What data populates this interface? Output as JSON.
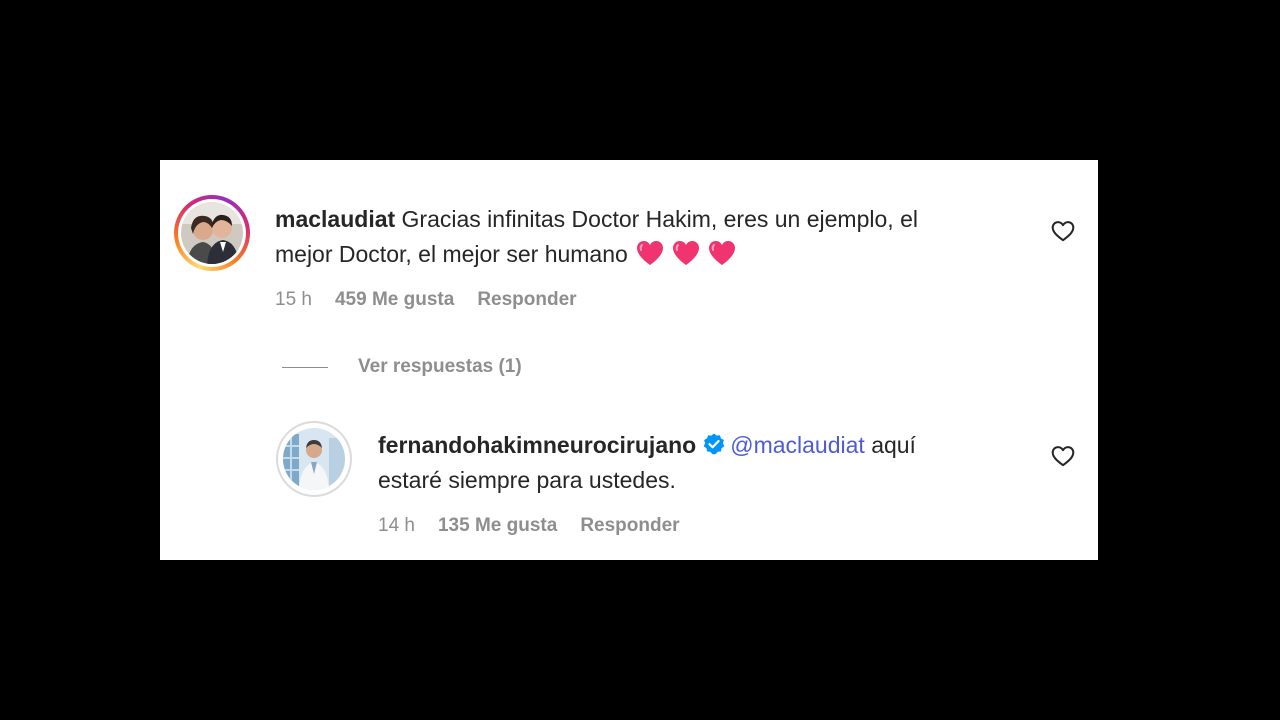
{
  "comments": [
    {
      "username": "maclaudiat",
      "text": "Gracias infinitas Doctor Hakim, eres un ejemplo, el",
      "text_line2": "mejor Doctor, el mejor ser humano",
      "emojis": [
        "pink-heart",
        "pink-heart",
        "pink-heart"
      ],
      "time": "15 h",
      "likes": "459 Me gusta",
      "reply_label": "Responder"
    },
    {
      "username": "fernandohakimneurocirujano",
      "verified": true,
      "mention": "@maclaudiat",
      "text": "aquí",
      "text_line2": "estaré siempre para ustedes.",
      "time": "14 h",
      "likes": "135 Me gusta",
      "reply_label": "Responder"
    }
  ],
  "view_replies_label": "Ver respuestas (1)",
  "colors": {
    "text": "#262626",
    "muted": "#8e8e8e",
    "mention": "#4f5bd5",
    "verified": "#0095f6",
    "emoji_heart": "#f0346f"
  }
}
